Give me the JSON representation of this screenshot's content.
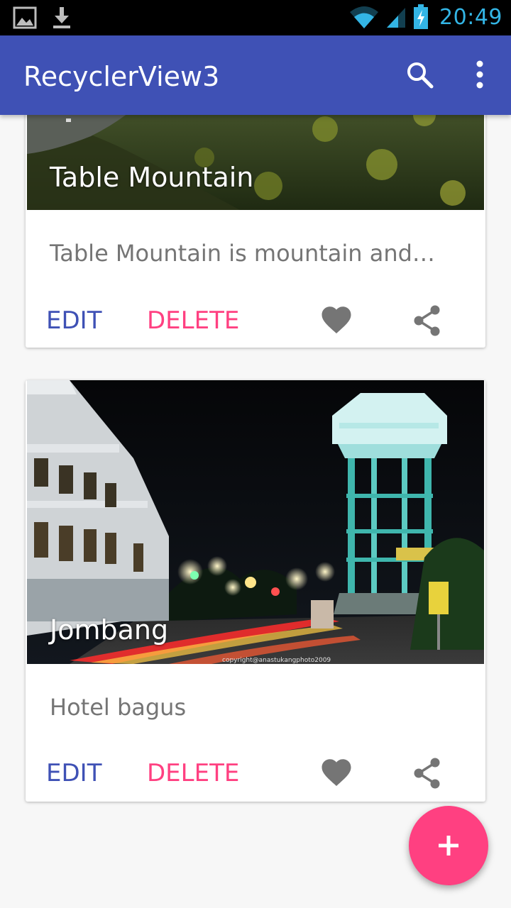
{
  "status_bar": {
    "time": "20:49",
    "left_icons": [
      "image-icon",
      "download-icon"
    ],
    "right_icons": [
      "wifi-icon",
      "signal-icon",
      "battery-charging-icon"
    ]
  },
  "app_bar": {
    "title": "RecyclerView3",
    "background": "#3f51b5",
    "actions": [
      "search-icon",
      "more-vert-icon"
    ]
  },
  "cards": [
    {
      "title": "Table Mountain",
      "description": "Table Mountain is mountain and…",
      "edit_label": "EDIT",
      "delete_label": "DELETE",
      "actions": [
        "favorite-icon",
        "share-icon"
      ]
    },
    {
      "title": "Jombang",
      "description": "Hotel bagus",
      "edit_label": "EDIT",
      "delete_label": "DELETE",
      "image_watermark": "copyright@anastukangphoto2009",
      "actions": [
        "favorite-icon",
        "share-icon"
      ]
    }
  ],
  "fab": {
    "icon": "add-icon",
    "color": "#ff4081"
  },
  "colors": {
    "primary": "#3f51b5",
    "accent": "#ff4081",
    "status_time": "#33b5e5"
  }
}
